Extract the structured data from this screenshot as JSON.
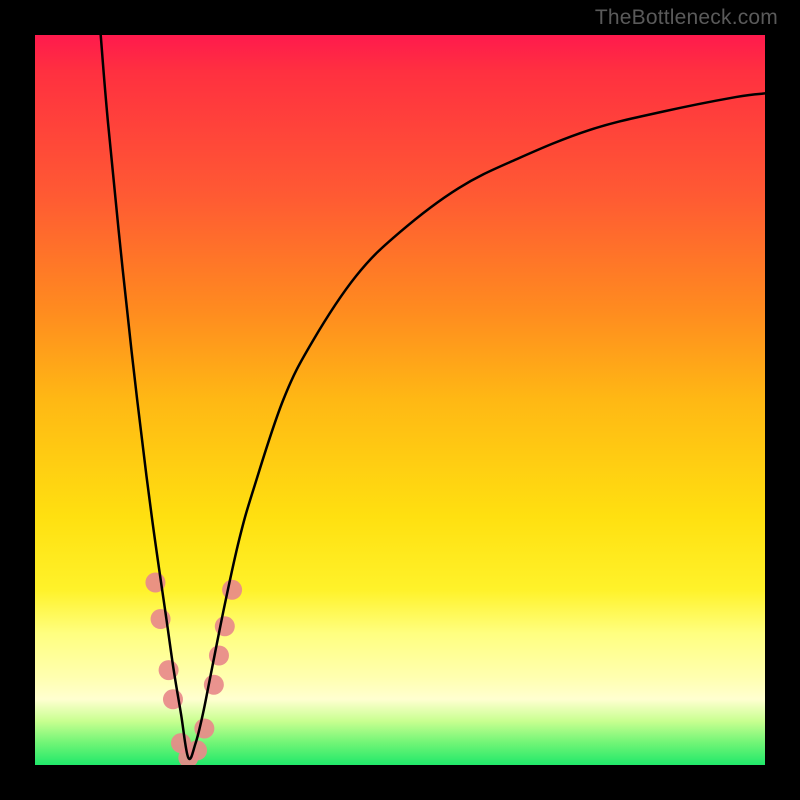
{
  "watermark": {
    "text": "TheBottleneck.com"
  },
  "chart_data": {
    "type": "line",
    "title": "",
    "xlabel": "",
    "ylabel": "",
    "xlim": [
      0,
      100
    ],
    "ylim": [
      0,
      100
    ],
    "grid": false,
    "legend": false,
    "note": "V-shaped bottleneck curve overlaid on a red-to-green vertical gradient. y≈100 is worst (red), y≈0 is best (green). Minimum (optimal balance) is at roughly x≈21.",
    "series": [
      {
        "name": "bottleneck-curve",
        "color": "#000000",
        "x": [
          9,
          10,
          12,
          14,
          16,
          18,
          19,
          20,
          21,
          22,
          23,
          24,
          26,
          28,
          30,
          34,
          38,
          44,
          50,
          58,
          66,
          76,
          86,
          96,
          100
        ],
        "y": [
          100,
          88,
          68,
          50,
          34,
          20,
          13,
          7,
          1,
          3,
          7,
          12,
          22,
          31,
          38,
          50,
          58,
          67,
          73,
          79,
          83,
          87,
          89.5,
          91.5,
          92
        ]
      }
    ],
    "markers": {
      "name": "highlighted-points",
      "description": "Soft pink rounded markers clustered near the valley of the V, on both sides of the minimum.",
      "color": "#e88a8a",
      "radius_px": 10,
      "points": [
        {
          "x": 16.5,
          "y": 25
        },
        {
          "x": 17.2,
          "y": 20
        },
        {
          "x": 18.3,
          "y": 13
        },
        {
          "x": 18.9,
          "y": 9
        },
        {
          "x": 20.0,
          "y": 3
        },
        {
          "x": 21.0,
          "y": 1
        },
        {
          "x": 22.2,
          "y": 2
        },
        {
          "x": 23.2,
          "y": 5
        },
        {
          "x": 24.5,
          "y": 11
        },
        {
          "x": 25.2,
          "y": 15
        },
        {
          "x": 26.0,
          "y": 19
        },
        {
          "x": 27.0,
          "y": 24
        }
      ]
    }
  }
}
